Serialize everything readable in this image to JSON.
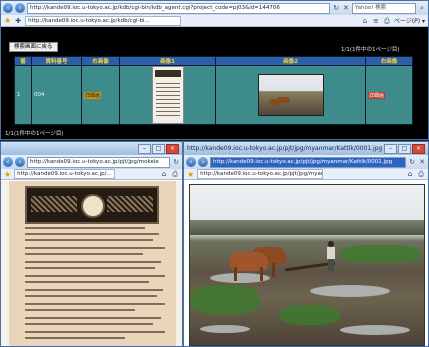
{
  "main_window": {
    "url": "http://kande09.ioc.u-tokyo.ac.jp/kdb/cgi-bin/kdb_agent.cgi?project_code=pj03&id=144706",
    "tab": "http://kande09.ioc.u-tokyo.ac.jp/kdb/cgi-bi...",
    "search_placeholder": "Yahoo! 検索",
    "page_menu": "ページ(P) ▾",
    "back_button": "検索画面に戻る",
    "page_info_top": "1/1(1件中の1ページ目)",
    "page_info_bottom": "1/1(1件中の1ページ目)",
    "table": {
      "headers": [
        "番",
        "資料番号",
        "右画像",
        "画像1",
        "画像2",
        "右画像"
      ],
      "row": {
        "num": "1",
        "id": "004",
        "tag_left": "詳細画",
        "tag_right": "詳細画"
      }
    }
  },
  "doc_window": {
    "url": "http://kande09.ioc.u-tokyo.ac.jp/pjt/jpg/mokele",
    "tab": "http://kande09.ioc.u-tokyo.ac.jp/..."
  },
  "photo_window": {
    "title": "http://kande09.ioc.u-tokyo.ac.jp/pjt/jpg/myanmar/Kattlk/0001.jpg - Windows Internet Explorer",
    "url": "http://kande09.ioc.u-tokyo.ac.jp/pjt/jpg/myanmar/Kattlk/0001.jpg",
    "tab": "http://kande09.ioc.u-tokyo.ac.jp/pjt/jpg/myan..."
  },
  "colors": {
    "table_header": "#2c5fa8",
    "table_cell": "#3d8b8b",
    "header_text": "#f5d23a"
  },
  "icons": [
    "back-arrow-icon",
    "forward-arrow-icon",
    "refresh-icon",
    "stop-icon",
    "favorites-star-icon",
    "home-icon",
    "print-icon"
  ]
}
